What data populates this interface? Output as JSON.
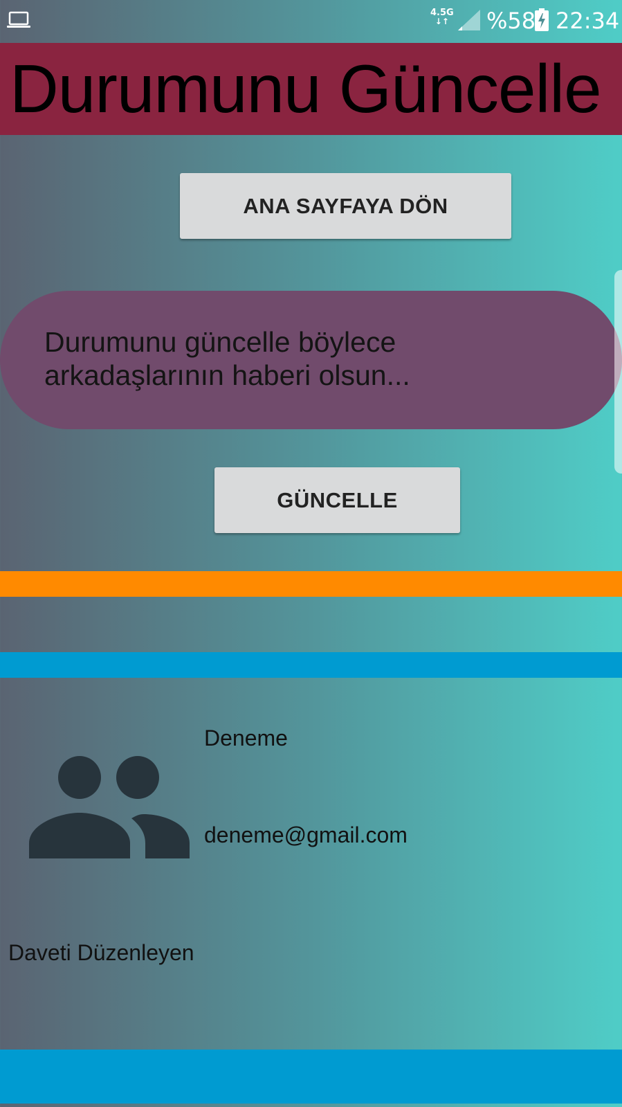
{
  "status_bar": {
    "network": "4.5G",
    "battery": "%58",
    "time": "22:34"
  },
  "header": {
    "title": "Durumunu Güncelle"
  },
  "buttons": {
    "home_label": "ANA SAYFAYA DÖN",
    "update_label": "GÜNCELLE"
  },
  "status_input": {
    "placeholder": "Durumunu güncelle böylece arkadaşlarının haberi olsun..."
  },
  "profile": {
    "name": "Deneme",
    "email": "deneme@gmail.com",
    "organizer_label": "Daveti Düzenleyen"
  },
  "colors": {
    "header_bg": "#8a2440",
    "input_bg": "#714b6c",
    "button_bg": "#d9dadb",
    "band_orange": "#ff8a00",
    "band_blue": "#009bd1",
    "icon_color": "#27343c"
  }
}
